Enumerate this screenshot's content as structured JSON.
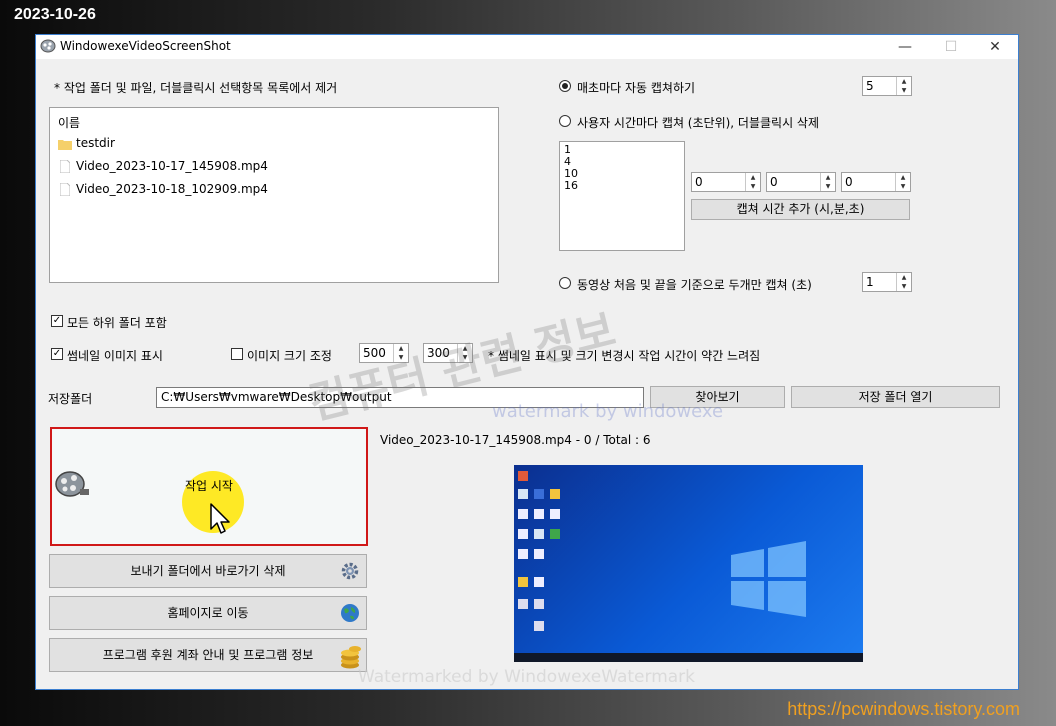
{
  "overlay": {
    "date": "2023-10-26",
    "site_url": "https://pcwindows.tistory.com",
    "watermark_main": "컴퓨터 관련 정보",
    "watermark_sub": "watermark by windowexe",
    "watermark_bottom": "Watermarked by WindowexeWatermark"
  },
  "window": {
    "title": "WindowexeVideoScreenShot",
    "minimize": "—",
    "maximize": "☐",
    "close": "✕"
  },
  "file_panel": {
    "hint": "* 작업 폴더 및 파일, 더블클릭시 선택항목 목록에서 제거",
    "header": "이름",
    "items": [
      {
        "name": "testdir",
        "kind": "folder"
      },
      {
        "name": "Video_2023-10-17_145908.mp4",
        "kind": "file"
      },
      {
        "name": "Video_2023-10-18_102909.mp4",
        "kind": "file"
      }
    ]
  },
  "capture": {
    "every_sec_label": "매초마다 자동 캡쳐하기",
    "every_sec_value": "5",
    "user_time_label": "사용자 시간마다 캡쳐 (초단위), 더블클릭시 삭제",
    "times": [
      "1",
      "4",
      "10",
      "16"
    ],
    "hour": "0",
    "minute": "0",
    "second": "0",
    "add_time_button": "캡쳐 시간 추가 (시,분,초)",
    "start_end_label": "동영상 처음 및 끝을 기준으로 두개만 캡쳐 (초)",
    "start_end_value": "1"
  },
  "options": {
    "include_subfolders": "모든 하위 폴더 포함",
    "show_thumbnail": "썸네일 이미지 표시",
    "resize_image": "이미지 크기 조정",
    "width": "500",
    "height": "300",
    "note": "* 썸네일 표시 및 크기 변경시 작업 시간이 약간 느려짐",
    "check_mark": "✓"
  },
  "save": {
    "label": "저장폴더",
    "path": "C:₩Users₩vmware₩Desktop₩output",
    "browse_button": "찾아보기",
    "open_button": "저장 폴더 열기"
  },
  "actions": {
    "start_button": "작업 시작",
    "remove_shortcut_button": "보내기 폴더에서 바로가기 삭제",
    "homepage_button": "홈페이지로 이동",
    "donate_button": "프로그램 후원 계좌 안내 및 프로그램 정보"
  },
  "status": {
    "progress_text": "Video_2023-10-17_145908.mp4 - 0 / Total : 6"
  },
  "colors": {
    "accent": "#3c7fd0",
    "start_border": "#d01818",
    "desktop_blue": "#0a5ad6"
  }
}
